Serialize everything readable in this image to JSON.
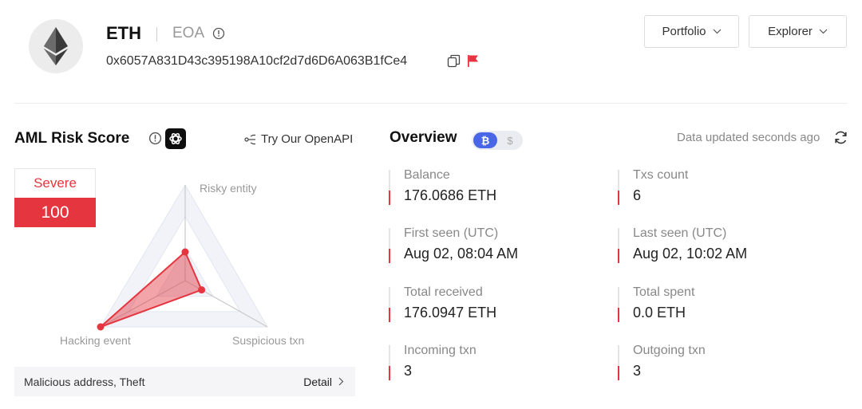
{
  "header": {
    "coin": "ETH",
    "account_type": "EOA",
    "address": "0x6057A831D43c395198A10cf2d7d6D6A063B1fCe4",
    "portfolio_label": "Portfolio",
    "explorer_label": "Explorer"
  },
  "aml": {
    "title": "AML Risk Score",
    "openapi_label": "Try Our OpenAPI",
    "severity_label": "Severe",
    "score": "100",
    "tags": "Malicious address, Theft",
    "detail_label": "Detail",
    "risk_color": "#e5353f",
    "radar": {
      "axes": [
        "Risky entity",
        "Hacking event",
        "Suspicious txn"
      ],
      "levels": [
        0.3,
        1.0,
        0.2
      ]
    }
  },
  "overview": {
    "title": "Overview",
    "currency_active": "₿",
    "currency_inactive": "$",
    "updated_text": "Data updated seconds ago",
    "accent_color": "#4a66e8",
    "stats": [
      {
        "label": "Balance",
        "value": "176.0686 ETH"
      },
      {
        "label": "Txs count",
        "value": "6"
      },
      {
        "label": "First seen (UTC)",
        "value": "Aug 02, 08:04 AM"
      },
      {
        "label": "Last seen (UTC)",
        "value": "Aug 02, 10:02 AM"
      },
      {
        "label": "Total received",
        "value": "176.0947 ETH"
      },
      {
        "label": "Total spent",
        "value": "0.0 ETH"
      },
      {
        "label": "Incoming txn",
        "value": "3"
      },
      {
        "label": "Outgoing txn",
        "value": "3"
      }
    ]
  }
}
